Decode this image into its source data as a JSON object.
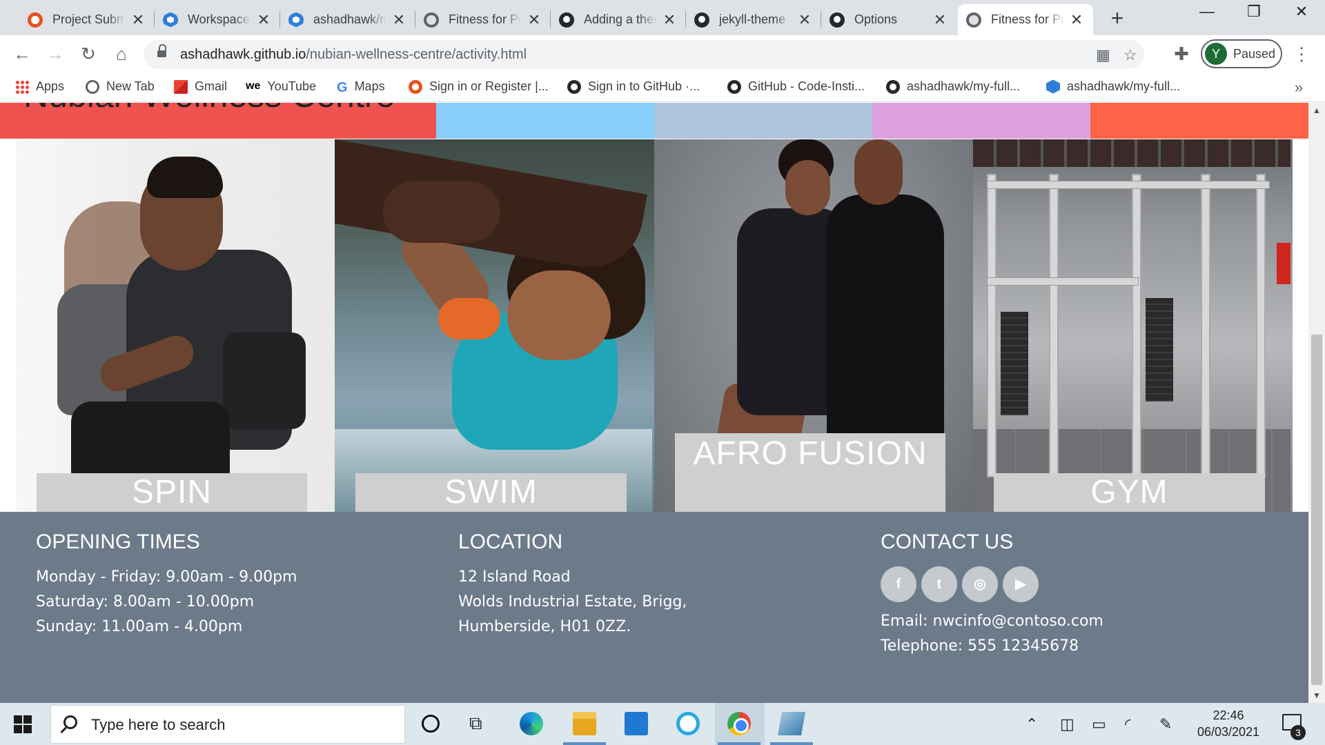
{
  "browser": {
    "tabs": [
      {
        "title": "Project Submission",
        "icon": "red-circle-icon"
      },
      {
        "title": "Workspaces",
        "icon": "gitpod-icon"
      },
      {
        "title": "ashadhawk/my-full",
        "icon": "gitpod-icon"
      },
      {
        "title": "Fitness for Purpose",
        "icon": "globe-icon"
      },
      {
        "title": "Adding a theme",
        "icon": "github-icon"
      },
      {
        "title": "jekyll-theme",
        "icon": "github-icon"
      },
      {
        "title": "Options",
        "icon": "github-icon"
      },
      {
        "title": "Fitness for Purpose",
        "icon": "globe-icon",
        "active": true
      }
    ],
    "new_tab_label": "+",
    "window_controls": {
      "minimize": "—",
      "restore": "❐",
      "close": "✕"
    },
    "url_host": "ashadhawk.github.io",
    "url_path": "/nubian-wellness-centre/activity.html",
    "profile": {
      "initial": "Y",
      "status": "Paused",
      "color": "#1e6b34"
    },
    "bookmarks": [
      {
        "label": "Apps",
        "icon": "apps-grid-icon"
      },
      {
        "label": "New Tab",
        "icon": "globe-icon"
      },
      {
        "label": "Gmail",
        "icon": "gmail-icon"
      },
      {
        "label": "YouTube",
        "icon": "we-icon"
      },
      {
        "label": "Maps",
        "icon": "google-icon"
      },
      {
        "label": "Sign in or Register |...",
        "icon": "red-circle-icon"
      },
      {
        "label": "Sign in to GitHub ·...",
        "icon": "github-icon"
      },
      {
        "label": "GitHub - Code-Insti...",
        "icon": "github-icon"
      },
      {
        "label": "ashadhawk/my-full...",
        "icon": "github-icon"
      },
      {
        "label": "ashadhawk/my-full...",
        "icon": "gitpod-icon"
      }
    ],
    "bookmarks_more": "»"
  },
  "page": {
    "site_title": "Nubian Wellness Centre",
    "header_colors": [
      "#ef5350",
      "#87cefa",
      "#b0c4de",
      "#dda0dd",
      "#ff6347"
    ],
    "activities": [
      {
        "label": "SPIN"
      },
      {
        "label": "SWIM"
      },
      {
        "label": "AFRO FUSION"
      },
      {
        "label": "GYM"
      }
    ],
    "footer": {
      "opening": {
        "heading": "OPENING TIMES",
        "lines": [
          "Monday - Friday: 9.00am - 9.00pm",
          "Saturday: 8.00am - 10.00pm",
          "Sunday: 11.00am - 4.00pm"
        ]
      },
      "location": {
        "heading": "LOCATION",
        "lines": [
          "12 Island Road",
          "Wolds Industrial Estate, Brigg,",
          "Humberside, H01 0ZZ."
        ]
      },
      "contact": {
        "heading": "CONTACT US",
        "socials": [
          {
            "name": "facebook",
            "glyph": "f"
          },
          {
            "name": "twitter",
            "glyph": "t"
          },
          {
            "name": "instagram",
            "glyph": "◎"
          },
          {
            "name": "youtube",
            "glyph": "▶"
          }
        ],
        "email": "Email: nwcinfo@contoso.com",
        "telephone": "Telephone: 555 12345678"
      }
    }
  },
  "taskbar": {
    "search_placeholder": "Type here to search",
    "time": "22:46",
    "date": "06/03/2021",
    "notifications": "3"
  }
}
